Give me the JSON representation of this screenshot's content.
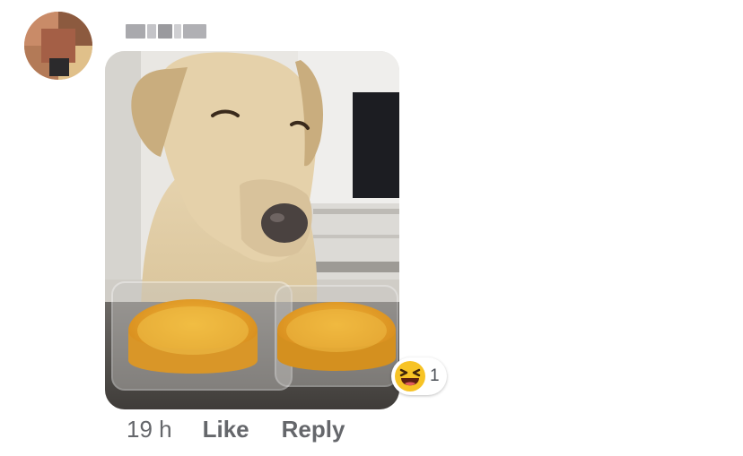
{
  "comment": {
    "author_name": "",
    "reactions": {
      "icon": "laughing-face-icon",
      "count": "1"
    },
    "actions": {
      "time": "19 h",
      "like_label": "Like",
      "reply_label": "Reply"
    }
  },
  "colors": {
    "meta_text": "#65676b",
    "reaction_yellow": "#f7c325",
    "background": "#ffffff"
  }
}
